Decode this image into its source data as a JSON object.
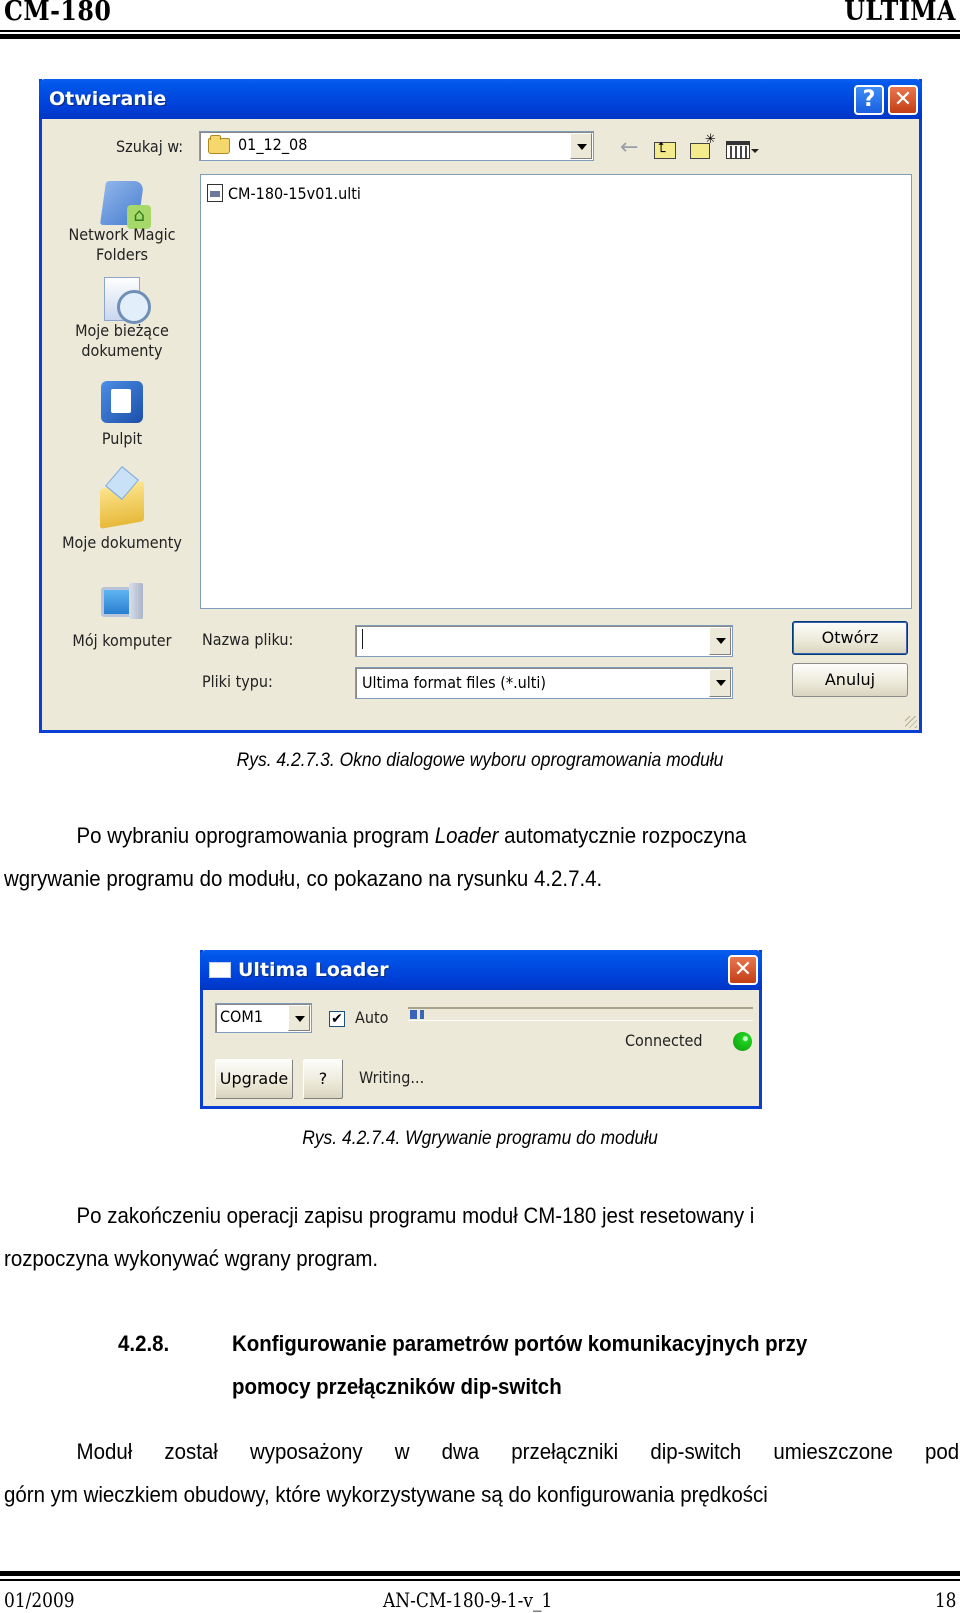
{
  "page_header": {
    "left": "CM-180",
    "right": "ULTIMA"
  },
  "open_dialog": {
    "title": "Otwieranie",
    "help_button": "?",
    "close_button": "✕",
    "look_in_label": "Szukaj w:",
    "look_in_value": "01_12_08",
    "toolbar": {
      "back_icon": "←"
    },
    "places": [
      {
        "label": "Network Magic Folders",
        "icon": "network-magic-folders-icon"
      },
      {
        "label": "Moje bieżące dokumenty",
        "icon": "recent-documents-icon"
      },
      {
        "label": "Pulpit",
        "icon": "desktop-icon"
      },
      {
        "label": "Moje dokumenty",
        "icon": "my-documents-icon"
      },
      {
        "label": "Mój komputer",
        "icon": "my-computer-icon"
      }
    ],
    "files": [
      {
        "name": "CM-180-15v01.ulti"
      }
    ],
    "filename_label": "Nazwa pliku:",
    "filename_value": "",
    "filetype_label": "Pliki typu:",
    "filetype_value": "Ultima format files (*.ulti)",
    "open_button": "Otwórz",
    "cancel_button": "Anuluj"
  },
  "caption1": "Rys. 4.2.7.3. Okno dialogowe wyboru oprogramowania modułu",
  "para1": {
    "line1_pre": "Po wybraniu oprogramowania program ",
    "line1_em": "Loader",
    "line1_post": " automatycznie rozpoczyna",
    "line2": "wgrywanie programu do modułu, co pokazano na rysunku 4.2.7.4."
  },
  "loader": {
    "title": "Ultima Loader",
    "close_button": "✕",
    "port_value": "COM1",
    "auto_label": "Auto",
    "auto_checked": true,
    "progress_percent": 4,
    "status_connection": "Connected",
    "status_color": "#1fd21f",
    "upgrade_button": "Upgrade",
    "help_button": "?",
    "operation_status": "Writing..."
  },
  "caption2": "Rys. 4.2.7.4. Wgrywanie programu do modułu",
  "para2": {
    "line1": "Po zakończeniu operacji zapisu programu moduł CM-180 jest resetowany i",
    "line2": "rozpoczyna wykonywać wgrany program."
  },
  "section": {
    "number": "4.2.8.",
    "title_line1": "Konfigurowanie parametrów portów komunikacyjnych przy",
    "title_line2": "pomocy przełączników dip-switch"
  },
  "para3": {
    "line1": "Moduł został wyposażony w dwa przełączniki dip-switch umieszczone pod",
    "line2": "górn  ym wieczkiem obudowy, które wykorzystywane są do konfigurowania prędkości"
  },
  "page_footer": {
    "date": "01/2009",
    "doc_id": "AN-CM-180-9-1-v_1",
    "page": "18"
  }
}
